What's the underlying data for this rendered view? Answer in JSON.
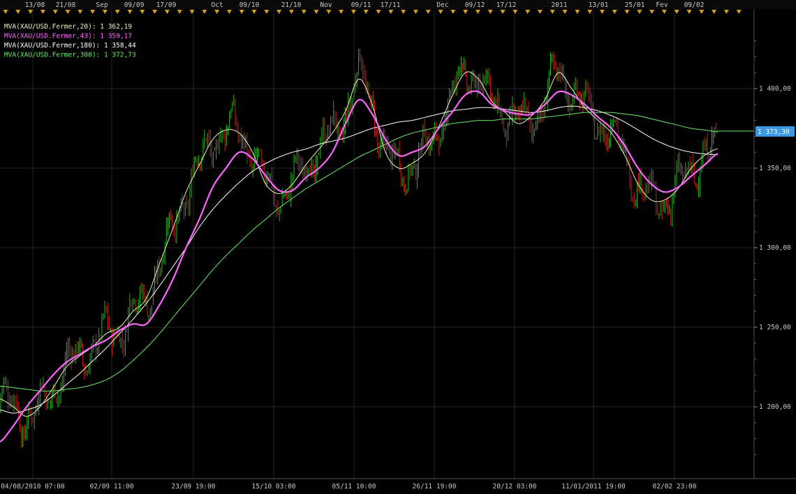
{
  "chart_data": {
    "type": "line",
    "instrument": "XAU/USD",
    "grid": true,
    "ylim": [
      1160,
      1440
    ],
    "top_axis_labels": [
      "13/08",
      "21/08",
      "Sep",
      "09/09",
      "17/09",
      "Oct",
      "09/10",
      "21/10",
      "Nov",
      "09/11",
      "17/11",
      "Dec",
      "09/12",
      "17/12",
      "2011",
      "13/01",
      "25/01",
      "Fev",
      "09/02"
    ],
    "bottom_axis_labels": [
      "04/08/2010 07:00",
      "02/09 11:00",
      "23/09 19:00",
      "15/10 03:00",
      "05/11 10:00",
      "26/11 19:00",
      "20/12 03:00",
      "11/01/2011 19:00",
      "02/02 23:00"
    ],
    "y_ticks": [
      1200,
      1250,
      1300,
      1350,
      1400
    ],
    "y_tick_labels": [
      "1 200,00",
      "1 250,00",
      "1 300,00",
      "1 350,00",
      "1 400,00"
    ],
    "last_price": 1373.3,
    "last_price_label": "1 373,30",
    "series": [
      {
        "name": "MVA(XAU/USD.Fermer,20)",
        "legend": "MVA(XAU/USD.Fermer,20): 1 362,19",
        "color": "#f0f0c0",
        "width": 1,
        "values": [
          1205,
          1200,
          1194,
          1200,
          1212,
          1225,
          1232,
          1238,
          1246,
          1250,
          1260,
          1268,
          1290,
          1312,
          1335,
          1352,
          1368,
          1374,
          1372,
          1360,
          1340,
          1334,
          1340,
          1352,
          1362,
          1372,
          1386,
          1406,
          1390,
          1360,
          1350,
          1353,
          1360,
          1376,
          1395,
          1410,
          1406,
          1392,
          1385,
          1378,
          1383,
          1393,
          1410,
          1400,
          1388,
          1380,
          1372,
          1358,
          1340,
          1330,
          1330,
          1337,
          1350,
          1358,
          1362.19
        ]
      },
      {
        "name": "MVA(XAU/USD.Fermer,43)",
        "legend": "MVA(XAU/USD.Fermer,43): 1 359,17",
        "color": "#ff66ff",
        "width": 2.2,
        "values": [
          1178,
          1188,
          1200,
          1210,
          1220,
          1228,
          1233,
          1238,
          1242,
          1248,
          1252,
          1252,
          1264,
          1280,
          1300,
          1318,
          1338,
          1350,
          1360,
          1356,
          1345,
          1336,
          1336,
          1344,
          1350,
          1360,
          1378,
          1393,
          1384,
          1368,
          1358,
          1360,
          1364,
          1375,
          1385,
          1396,
          1398,
          1390,
          1386,
          1384,
          1384,
          1390,
          1398,
          1396,
          1390,
          1382,
          1375,
          1364,
          1350,
          1340,
          1335,
          1338,
          1345,
          1352,
          1359.17
        ]
      },
      {
        "name": "MVA(XAU/USD.Fermer,180)",
        "legend": "MVA(XAU/USD.Fermer,180): 1 358,44",
        "color": "#ffffff",
        "width": 1,
        "values": [
          1198,
          1196,
          1198,
          1201,
          1207,
          1214,
          1221,
          1229,
          1237,
          1246,
          1255,
          1265,
          1276,
          1288,
          1300,
          1313,
          1324,
          1333,
          1341,
          1348,
          1353,
          1357,
          1360,
          1362,
          1365,
          1367,
          1369,
          1372,
          1375,
          1377,
          1379,
          1380,
          1382,
          1384,
          1386,
          1387,
          1388,
          1388,
          1387,
          1386,
          1385,
          1386,
          1388,
          1389,
          1388,
          1386,
          1383,
          1379,
          1374,
          1369,
          1365,
          1362,
          1360,
          1359,
          1358.44
        ]
      },
      {
        "name": "MVA(XAU/USD.Fermer,300)",
        "legend": "MVA(XAU/USD.Fermer,300): 1 372,73",
        "color": "#66ee66",
        "width": 1,
        "values": [
          1213,
          1212,
          1211,
          1210,
          1210,
          1211,
          1212,
          1214,
          1217,
          1222,
          1229,
          1237,
          1246,
          1256,
          1266,
          1276,
          1286,
          1295,
          1303,
          1311,
          1318,
          1325,
          1331,
          1337,
          1342,
          1347,
          1352,
          1357,
          1361,
          1365,
          1369,
          1372,
          1374,
          1376,
          1378,
          1379,
          1380,
          1380,
          1381,
          1381,
          1381,
          1382,
          1383,
          1384,
          1385,
          1385,
          1385,
          1384,
          1383,
          1381,
          1379,
          1377,
          1375,
          1374,
          1372.73
        ]
      }
    ]
  }
}
